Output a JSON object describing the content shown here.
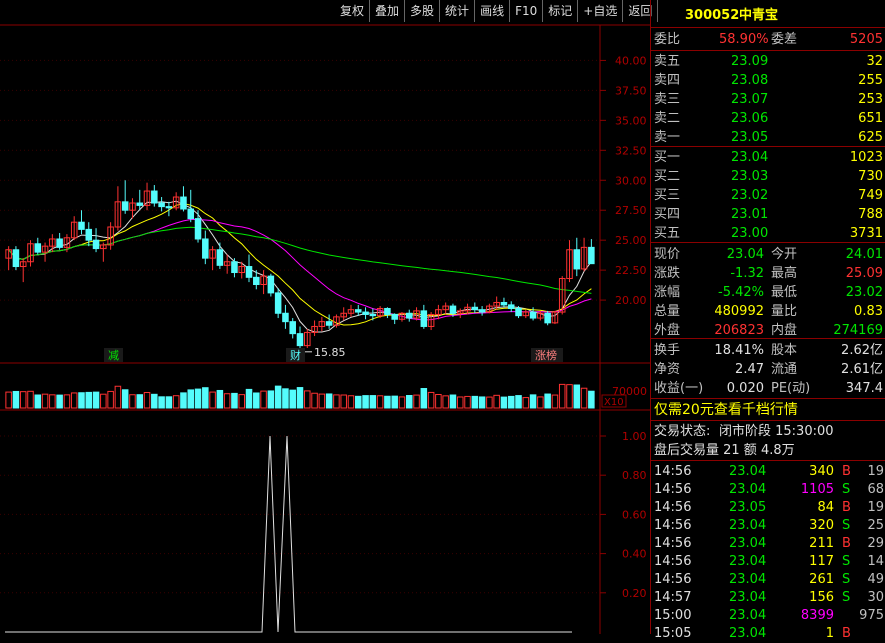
{
  "toolbar": [
    "复权",
    "叠加",
    "多股",
    "统计",
    "画线",
    "F10",
    "标记",
    "+自选",
    "返回"
  ],
  "stock": {
    "code": "300052",
    "name": "中青宝"
  },
  "weibi": {
    "label": "委比",
    "value": "58.90%",
    "label2": "委差",
    "value2": "5205"
  },
  "sells": [
    {
      "label": "卖五",
      "price": "23.09",
      "vol": "32"
    },
    {
      "label": "卖四",
      "price": "23.08",
      "vol": "255"
    },
    {
      "label": "卖三",
      "price": "23.07",
      "vol": "253"
    },
    {
      "label": "卖二",
      "price": "23.06",
      "vol": "651"
    },
    {
      "label": "卖一",
      "price": "23.05",
      "vol": "625"
    }
  ],
  "buys": [
    {
      "label": "买一",
      "price": "23.04",
      "vol": "1023"
    },
    {
      "label": "买二",
      "price": "23.03",
      "vol": "730"
    },
    {
      "label": "买三",
      "price": "23.02",
      "vol": "749"
    },
    {
      "label": "买四",
      "price": "23.01",
      "vol": "788"
    },
    {
      "label": "买五",
      "price": "23.00",
      "vol": "3731"
    }
  ],
  "quote": [
    {
      "l1": "现价",
      "v1": "23.04",
      "c1": "grn",
      "l2": "今开",
      "v2": "24.01",
      "c2": "grn"
    },
    {
      "l1": "涨跌",
      "v1": "-1.32",
      "c1": "grn",
      "l2": "最高",
      "v2": "25.09",
      "c2": "red"
    },
    {
      "l1": "涨幅",
      "v1": "-5.42%",
      "c1": "grn",
      "l2": "最低",
      "v2": "23.02",
      "c2": "grn"
    },
    {
      "l1": "总量",
      "v1": "480992",
      "c1": "yel",
      "l2": "量比",
      "v2": "0.83",
      "c2": "yel"
    },
    {
      "l1": "外盘",
      "v1": "206823",
      "c1": "red",
      "l2": "内盘",
      "v2": "274169",
      "c2": "grn"
    }
  ],
  "info": [
    {
      "l1": "换手",
      "v1": "18.41%",
      "l2": "股本",
      "v2": "2.62亿"
    },
    {
      "l1": "净资",
      "v1": "2.47",
      "l2": "流通",
      "v2": "2.61亿"
    },
    {
      "l1": "收益(一)",
      "v1": "0.020",
      "l2": "PE(动)",
      "v2": "347.4"
    }
  ],
  "promo": "仅需20元查看千档行情",
  "status": {
    "label": "交易状态:",
    "value": "闭市阶段 15:30:00"
  },
  "after": "盘后交易量 21 额 4.8万",
  "ticks": [
    {
      "t": "14:56",
      "p": "23.04",
      "v": "340",
      "vc": "yel",
      "s": "B",
      "sc": "red",
      "n": "19"
    },
    {
      "t": "14:56",
      "p": "23.04",
      "v": "1105",
      "vc": "mag",
      "s": "S",
      "sc": "grn",
      "n": "68"
    },
    {
      "t": "14:56",
      "p": "23.05",
      "v": "84",
      "vc": "yel",
      "s": "B",
      "sc": "red",
      "n": "19"
    },
    {
      "t": "14:56",
      "p": "23.04",
      "v": "320",
      "vc": "yel",
      "s": "S",
      "sc": "grn",
      "n": "25"
    },
    {
      "t": "14:56",
      "p": "23.04",
      "v": "211",
      "vc": "yel",
      "s": "B",
      "sc": "red",
      "n": "29"
    },
    {
      "t": "14:56",
      "p": "23.04",
      "v": "117",
      "vc": "yel",
      "s": "S",
      "sc": "grn",
      "n": "14"
    },
    {
      "t": "14:56",
      "p": "23.04",
      "v": "261",
      "vc": "yel",
      "s": "S",
      "sc": "grn",
      "n": "49"
    },
    {
      "t": "14:57",
      "p": "23.04",
      "v": "156",
      "vc": "yel",
      "s": "S",
      "sc": "grn",
      "n": "30"
    },
    {
      "t": "15:00",
      "p": "23.04",
      "v": "8399",
      "vc": "mag",
      "s": "",
      "sc": "grn",
      "n": "975"
    },
    {
      "t": "15:05",
      "p": "23.04",
      "v": "1",
      "vc": "yel",
      "s": "B",
      "sc": "red",
      "n": ""
    }
  ],
  "chart": {
    "price_ticks": [
      "40.00",
      "37.50",
      "35.00",
      "32.50",
      "30.00",
      "27.50",
      "25.00",
      "22.50",
      "20.00"
    ],
    "low_label": "15.85",
    "markers": [
      "减",
      "财",
      "涨榜"
    ],
    "vol_tick": "70000",
    "vol_unit": "X10",
    "ind_ticks": [
      "1.00",
      "0.80",
      "0.60",
      "0.40",
      "0.20"
    ]
  },
  "chart_data": {
    "type": "candlestick",
    "ylim": [
      15,
      41
    ],
    "candles": [
      [
        23.5,
        24.5,
        22.5,
        24.2
      ],
      [
        24.2,
        24.5,
        22.5,
        22.8
      ],
      [
        22.8,
        23.5,
        21.5,
        23.2
      ],
      [
        23.2,
        25,
        22.8,
        24.7
      ],
      [
        24.7,
        25.2,
        23.8,
        24
      ],
      [
        24,
        24.8,
        23.2,
        24.5
      ],
      [
        24.5,
        25.5,
        24,
        25.1
      ],
      [
        25.1,
        25.6,
        24.2,
        24.4
      ],
      [
        24.4,
        25.5,
        24,
        25.2
      ],
      [
        25.2,
        27,
        25,
        26.5
      ],
      [
        26.5,
        27.5,
        25.5,
        25.9
      ],
      [
        25.9,
        26.5,
        24.5,
        25
      ],
      [
        25,
        26,
        24,
        24.3
      ],
      [
        24.3,
        24.8,
        23.2,
        24.6
      ],
      [
        24.6,
        26.5,
        24.2,
        26.1
      ],
      [
        26.1,
        29.5,
        25.8,
        28.2
      ],
      [
        28.2,
        30,
        27.2,
        27.5
      ],
      [
        27.5,
        28.5,
        26.8,
        28.1
      ],
      [
        28.1,
        29.2,
        27.5,
        27.9
      ],
      [
        27.9,
        29.8,
        27.5,
        29.1
      ],
      [
        29.1,
        29.6,
        27.8,
        28.1
      ],
      [
        28.1,
        28.6,
        27.4,
        27.8
      ],
      [
        27.8,
        28.2,
        27,
        27.7
      ],
      [
        27.7,
        29,
        27.5,
        28.6
      ],
      [
        28.6,
        29.5,
        27.4,
        27.6
      ],
      [
        27.6,
        29.2,
        26.5,
        26.8
      ],
      [
        26.8,
        27.5,
        24.8,
        25.1
      ],
      [
        25.1,
        25.8,
        23,
        23.5
      ],
      [
        23.5,
        24.5,
        22.5,
        24.2
      ],
      [
        24.2,
        24.8,
        22.6,
        22.9
      ],
      [
        22.9,
        23.8,
        22.2,
        23.2
      ],
      [
        23.2,
        23.5,
        21.9,
        22.3
      ],
      [
        22.3,
        23.2,
        21.8,
        22.8
      ],
      [
        22.8,
        23.8,
        21.5,
        21.9
      ],
      [
        21.9,
        22.5,
        20.9,
        21.3
      ],
      [
        21.3,
        22.5,
        20.5,
        22
      ],
      [
        22,
        22.2,
        20.3,
        20.6
      ],
      [
        20.6,
        21,
        18.5,
        18.9
      ],
      [
        18.9,
        19.6,
        17.6,
        18.2
      ],
      [
        18.2,
        18.5,
        16.8,
        17.2
      ],
      [
        17.2,
        17.8,
        15.85,
        16.2
      ],
      [
        16.2,
        17.6,
        16,
        17.3
      ],
      [
        17.3,
        18.3,
        17,
        17.8
      ],
      [
        17.8,
        18.6,
        17.4,
        18.2
      ],
      [
        18.2,
        18.8,
        17.6,
        17.9
      ],
      [
        17.9,
        18.8,
        17.7,
        18.6
      ],
      [
        18.6,
        19.4,
        18.3,
        18.9
      ],
      [
        18.9,
        19.6,
        18.6,
        19.2
      ],
      [
        19.2,
        19.6,
        18.7,
        19
      ],
      [
        19,
        19.4,
        18.4,
        18.8
      ],
      [
        18.8,
        19.3,
        18.3,
        18.7
      ],
      [
        18.7,
        19.5,
        18.5,
        19.3
      ],
      [
        19.3,
        19.4,
        18.5,
        18.8
      ],
      [
        18.8,
        18.9,
        18,
        18.4
      ],
      [
        18.4,
        19,
        18.2,
        18.9
      ],
      [
        18.9,
        19.2,
        18.2,
        18.5
      ],
      [
        18.5,
        19.4,
        18.3,
        19.1
      ],
      [
        19.1,
        19.6,
        17.6,
        17.8
      ],
      [
        17.8,
        19,
        17.5,
        18.8
      ],
      [
        18.8,
        19.6,
        18.4,
        19.2
      ],
      [
        19.2,
        19.8,
        18.8,
        19.5
      ],
      [
        19.5,
        19.7,
        18.6,
        18.9
      ],
      [
        18.9,
        19.3,
        18.5,
        19.1
      ],
      [
        19.1,
        19.7,
        18.8,
        19.4
      ],
      [
        19.4,
        19.8,
        18.9,
        19.2
      ],
      [
        19.2,
        19.5,
        18.7,
        19
      ],
      [
        19,
        19.7,
        18.9,
        19.5
      ],
      [
        19.5,
        20.3,
        19.2,
        19.8
      ],
      [
        19.8,
        20.2,
        19.4,
        19.6
      ],
      [
        19.6,
        19.9,
        19,
        19.3
      ],
      [
        19.3,
        19.5,
        18.5,
        18.7
      ],
      [
        18.7,
        19.2,
        18.5,
        19
      ],
      [
        19,
        19.4,
        18.3,
        18.5
      ],
      [
        18.5,
        19.1,
        18.3,
        18.9
      ],
      [
        18.9,
        19.1,
        17.9,
        18.1
      ],
      [
        18.1,
        19.1,
        18,
        19
      ],
      [
        19,
        22,
        18.8,
        21.8
      ],
      [
        21.8,
        25,
        21.5,
        24.2
      ],
      [
        24.2,
        25.2,
        22,
        22.6
      ],
      [
        22.6,
        25.2,
        22.4,
        24.4
      ],
      [
        24.4,
        25.09,
        23.02,
        23.04
      ]
    ]
  }
}
